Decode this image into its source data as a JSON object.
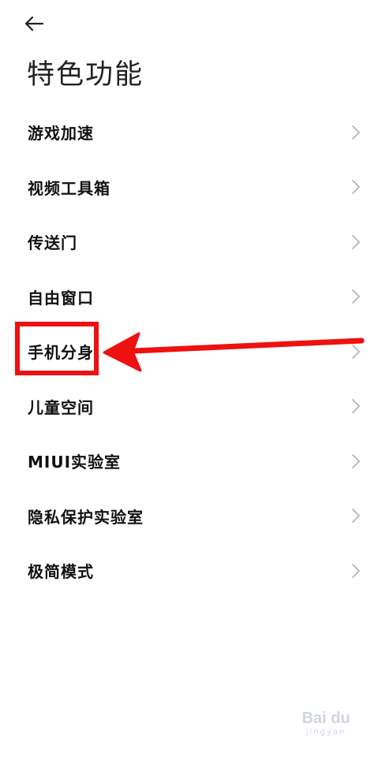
{
  "header": {
    "back_icon": "arrow-left-icon",
    "title": "特色功能"
  },
  "menu": {
    "items": [
      {
        "label": "游戏加速",
        "icon": "chevron-right-icon"
      },
      {
        "label": "视频工具箱",
        "icon": "chevron-right-icon"
      },
      {
        "label": "传送门",
        "icon": "chevron-right-icon"
      },
      {
        "label": "自由窗口",
        "icon": "chevron-right-icon"
      },
      {
        "label": "手机分身",
        "icon": "chevron-right-icon"
      },
      {
        "label": "儿童空间",
        "icon": "chevron-right-icon"
      },
      {
        "label": "MIUI实验室",
        "icon": "chevron-right-icon"
      },
      {
        "label": "隐私保护实验室",
        "icon": "chevron-right-icon"
      },
      {
        "label": "极简模式",
        "icon": "chevron-right-icon"
      }
    ]
  },
  "annotation": {
    "highlighted_item": "手机分身",
    "color": "#ee1111"
  },
  "watermark": {
    "brand": "Bai du",
    "sub": "jingyan"
  },
  "colors": {
    "background": "#ffffff",
    "text": "#111111",
    "chevron": "#b5b5b5",
    "annotation": "#ee1111"
  }
}
